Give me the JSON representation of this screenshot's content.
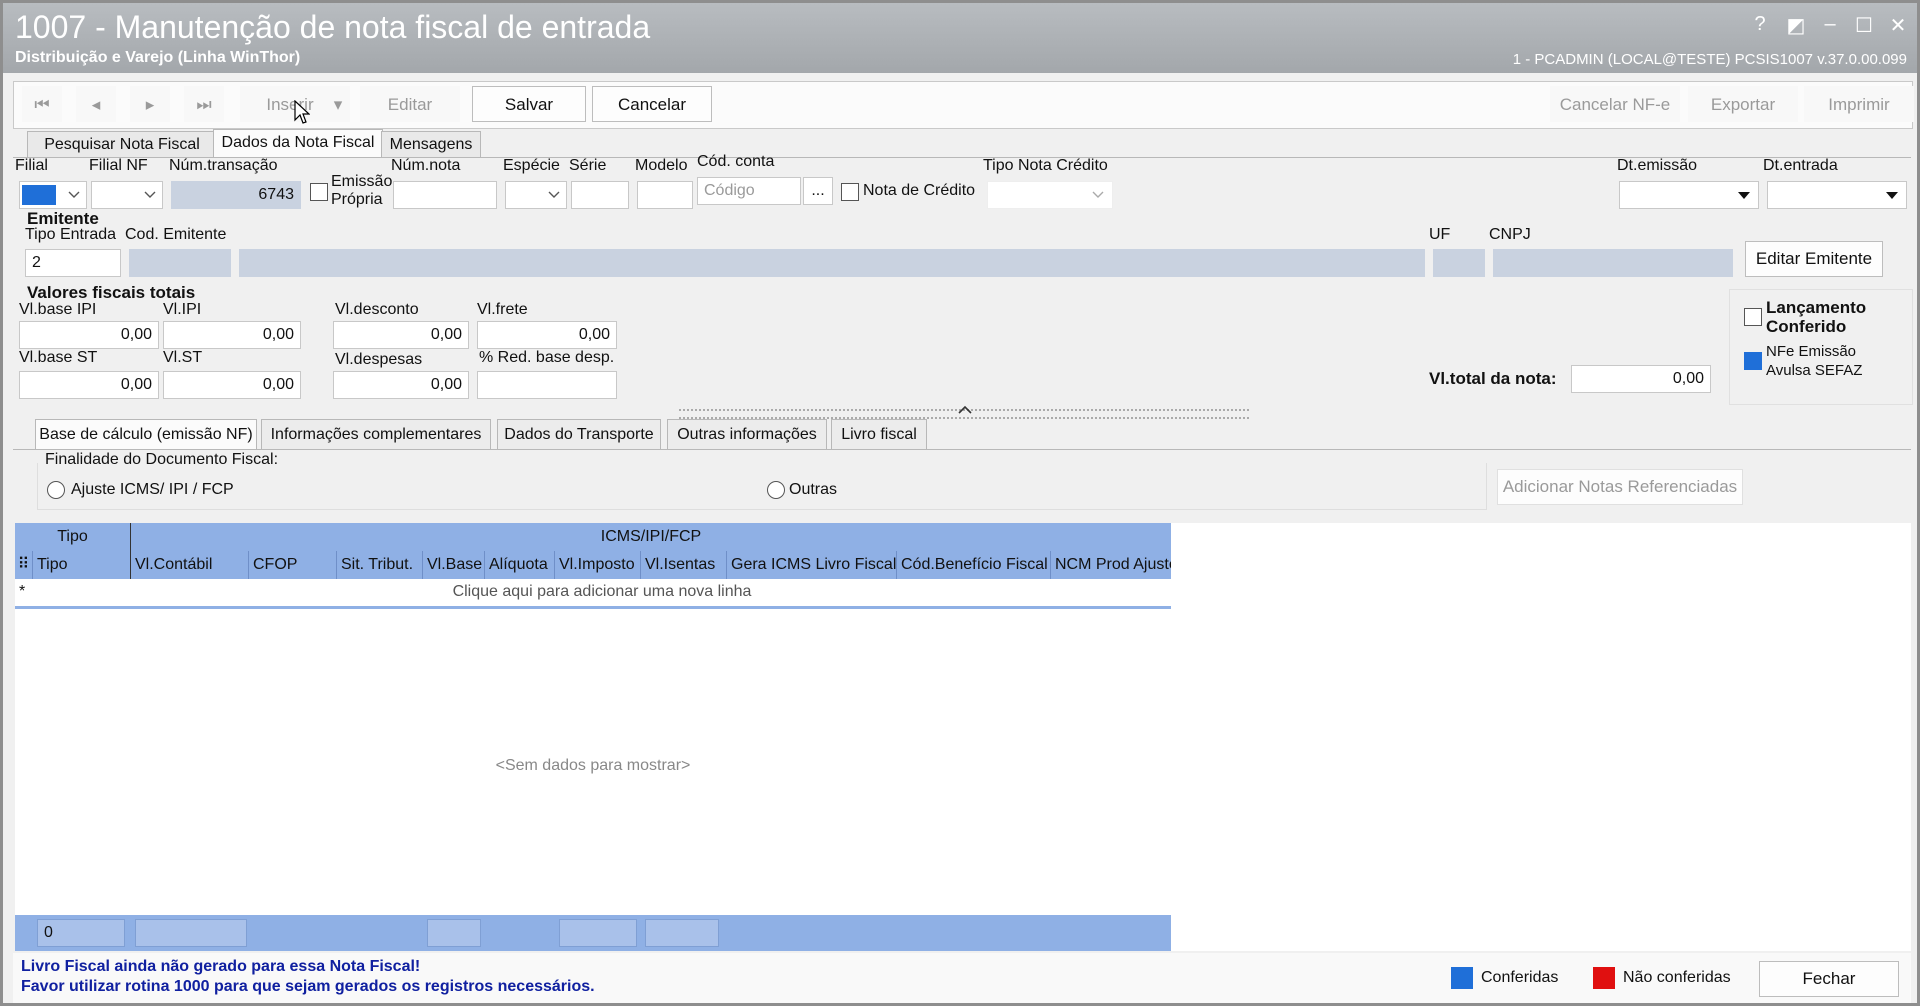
{
  "window": {
    "title": "1007 - Manutenção de nota fiscal de entrada",
    "subtitle": "Distribuição e Varejo (Linha WinThor)",
    "userinfo": "1 - PCADMIN (LOCAL@TESTE)   PCSIS1007  v.37.0.00.099",
    "help": "?",
    "restore": "◩",
    "minimize": "–",
    "maximize": "☐",
    "close": "✕"
  },
  "toolbar": {
    "first": "⏮",
    "prev": "◂",
    "next": "▸",
    "last": "⏭",
    "insert": "Inserir",
    "insert_arrow": "▾",
    "edit": "Editar",
    "save": "Salvar",
    "cancel": "Cancelar",
    "cancel_nfe": "Cancelar NF-e",
    "export": "Exportar",
    "print": "Imprimir"
  },
  "tabs": [
    "Pesquisar Nota Fiscal",
    "Dados da Nota Fiscal",
    "Mensagens"
  ],
  "header": {
    "filial_label": "Filial",
    "filial_nf_label": "Filial NF",
    "num_transacao_label": "Núm.transação",
    "num_transacao_value": "6743",
    "emissao_propria_line1": "Emissão",
    "emissao_propria_line2": "Própria",
    "num_nota_label": "Núm.nota",
    "especie_label": "Espécie",
    "serie_label": "Série",
    "modelo_label": "Modelo",
    "cod_conta_label": "Cód. conta",
    "cod_conta_placeholder": "Código",
    "ellipsis": "...",
    "nota_credito_label": "Nota de Crédito",
    "tipo_nota_credito_label": "Tipo Nota Crédito",
    "dt_emissao_label": "Dt.emissão",
    "dt_entrada_label": "Dt.entrada"
  },
  "emitente": {
    "group_title": "Emitente",
    "tipo_entrada_label": "Tipo Entrada",
    "tipo_entrada_value": "2",
    "cod_emitente_label": "Cod. Emitente",
    "uf_label": "UF",
    "cnpj_label": "CNPJ",
    "edit_button": "Editar Emitente"
  },
  "valores": {
    "group_title": "Valores fiscais totais",
    "vl_base_ipi_label": "Vl.base IPI",
    "vl_base_ipi": "0,00",
    "vl_ipi_label": "Vl.IPI",
    "vl_ipi": "0,00",
    "vl_desconto_label": "Vl.desconto",
    "vl_desconto": "0,00",
    "vl_frete_label": "Vl.frete",
    "vl_frete": "0,00",
    "vl_base_st_label": "Vl.base ST",
    "vl_base_st": "0,00",
    "vl_st_label": "Vl.ST",
    "vl_st": "0,00",
    "vl_despesas_label": "Vl.despesas",
    "vl_despesas": "0,00",
    "red_base_label": "% Red. base desp.",
    "vl_total_label": "Vl.total da nota:",
    "vl_total": "0,00",
    "lancamento_line1": "Lançamento",
    "lancamento_line2": "Conferido",
    "nfe_line1": "NFe Emissão",
    "nfe_line2": "Avulsa SEFAZ"
  },
  "bottom_tabs": [
    "Base de cálculo (emissão NF)",
    "Informações complementares",
    "Dados do Transporte",
    "Outras informações",
    "Livro fiscal"
  ],
  "finalidade": {
    "label": "Finalidade do Documento Fiscal:",
    "option1": "Ajuste ICMS/ IPI / FCP",
    "option2": "Outras",
    "add_button": "Adicionar Notas Referenciadas"
  },
  "grid": {
    "band_tipo": "Tipo",
    "band_icms": "ICMS/IPI/FCP",
    "columns": [
      "Tipo",
      "Vl.Contábil",
      "CFOP",
      "Sit. Tribut.",
      "Vl.Base",
      "Alíquota",
      "Vl.Imposto",
      "Vl.Isentas",
      "Gera ICMS Livro Fiscal",
      "Cód.Benefício Fiscal",
      "NCM Prod Ajuste"
    ],
    "new_row_marker": "*",
    "new_row_text": "Clique aqui para adicionar uma nova linha",
    "empty_text": "<Sem dados para mostrar>",
    "footer_count": "0"
  },
  "status": {
    "message_line1": "Livro Fiscal ainda não gerado para essa Nota Fiscal!",
    "message_line2": "Favor utilizar rotina 1000 para que sejam gerados os registros necessários.",
    "legend_conferidas": "Conferidas",
    "legend_nao_conferidas": "Não conferidas",
    "close_button": "Fechar"
  },
  "colors": {
    "grid_header": "#8fb0e5",
    "readonly_field": "#c9d2e0",
    "conferidas": "#1f6fd8",
    "nao_conferidas": "#e01010",
    "status_text": "#1020a0"
  }
}
